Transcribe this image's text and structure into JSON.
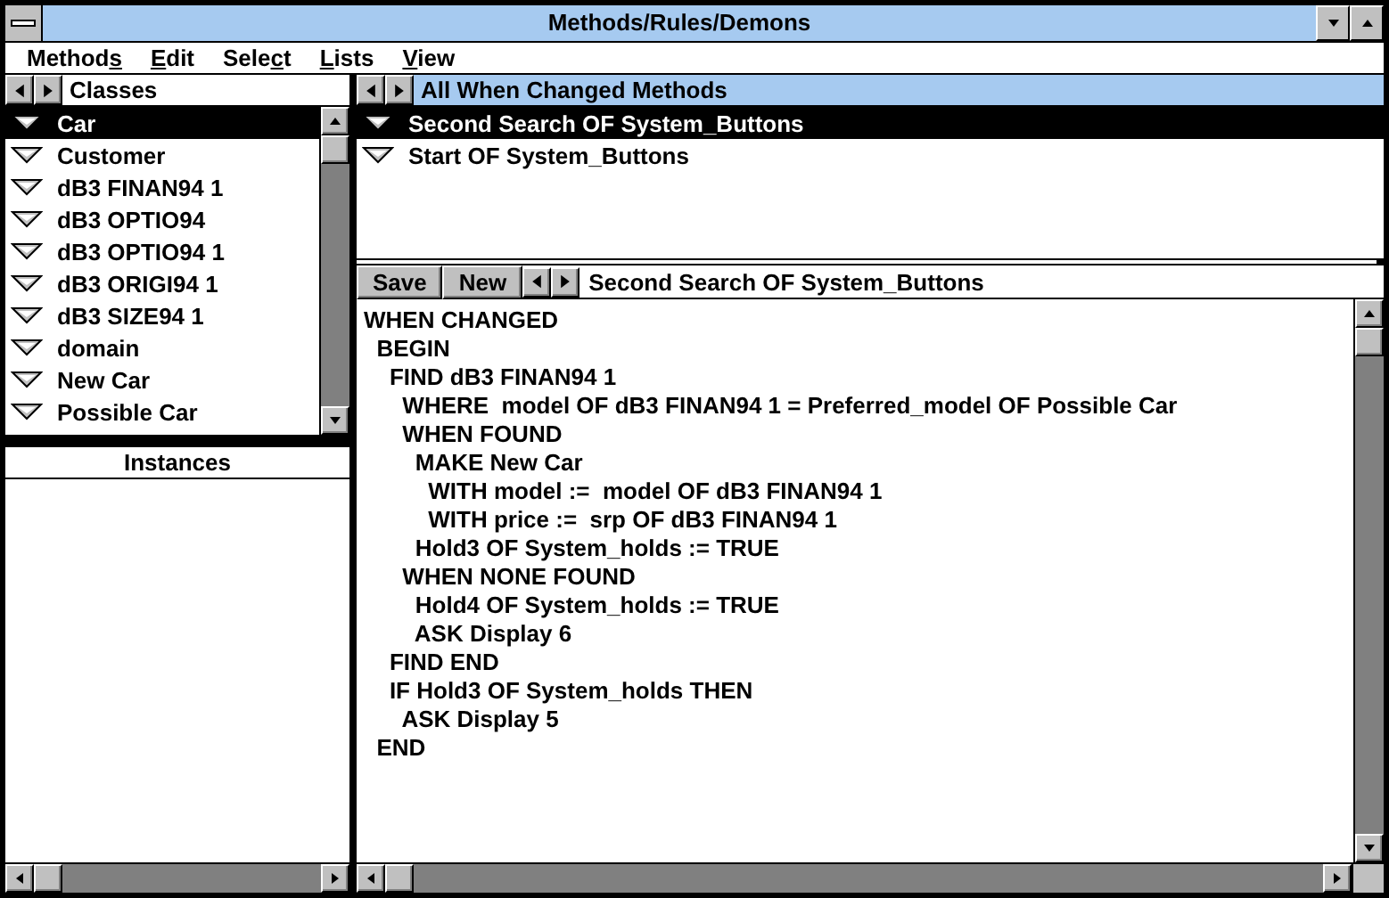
{
  "window": {
    "title": "Methods/Rules/Demons"
  },
  "menu": [
    {
      "before": "Method",
      "key": "s"
    },
    {
      "key": "E",
      "after": "dit"
    },
    {
      "before": "Sele",
      "key": "c",
      "after": "t"
    },
    {
      "key": "L",
      "after": "ists"
    },
    {
      "key": "V",
      "after": "iew"
    }
  ],
  "classes": {
    "title": "Classes",
    "items": [
      {
        "label": "Car",
        "selected": true
      },
      {
        "label": "Customer",
        "selected": false
      },
      {
        "label": "dB3 FINAN94 1",
        "selected": false
      },
      {
        "label": "dB3 OPTIO94",
        "selected": false
      },
      {
        "label": "dB3 OPTIO94 1",
        "selected": false
      },
      {
        "label": "dB3 ORIGI94 1",
        "selected": false
      },
      {
        "label": "dB3 SIZE94 1",
        "selected": false
      },
      {
        "label": "domain",
        "selected": false
      },
      {
        "label": "New Car",
        "selected": false
      },
      {
        "label": "Possible Car",
        "selected": false
      }
    ]
  },
  "instances": {
    "title": "Instances"
  },
  "methods": {
    "title": "All When Changed Methods",
    "items": [
      {
        "label": "Second Search OF System_Buttons",
        "selected": true
      },
      {
        "label": "Start OF System_Buttons",
        "selected": false
      }
    ]
  },
  "editor": {
    "buttons": [
      "Save",
      "New"
    ],
    "method_name": "Second Search OF System_Buttons",
    "code": [
      "WHEN CHANGED",
      "  BEGIN",
      "    FIND dB3 FINAN94 1",
      "      WHERE  model OF dB3 FINAN94 1 = Preferred_model OF Possible Car",
      "      WHEN FOUND",
      "        MAKE New Car",
      "          WITH model :=  model OF dB3 FINAN94 1",
      "          WITH price :=  srp OF dB3 FINAN94 1",
      "        Hold3 OF System_holds := TRUE",
      "      WHEN NONE FOUND",
      "        Hold4 OF System_holds := TRUE",
      "        ASK Display 6",
      "    FIND END",
      "    IF Hold3 OF System_holds THEN",
      "      ASK Display 5",
      "  END"
    ]
  }
}
